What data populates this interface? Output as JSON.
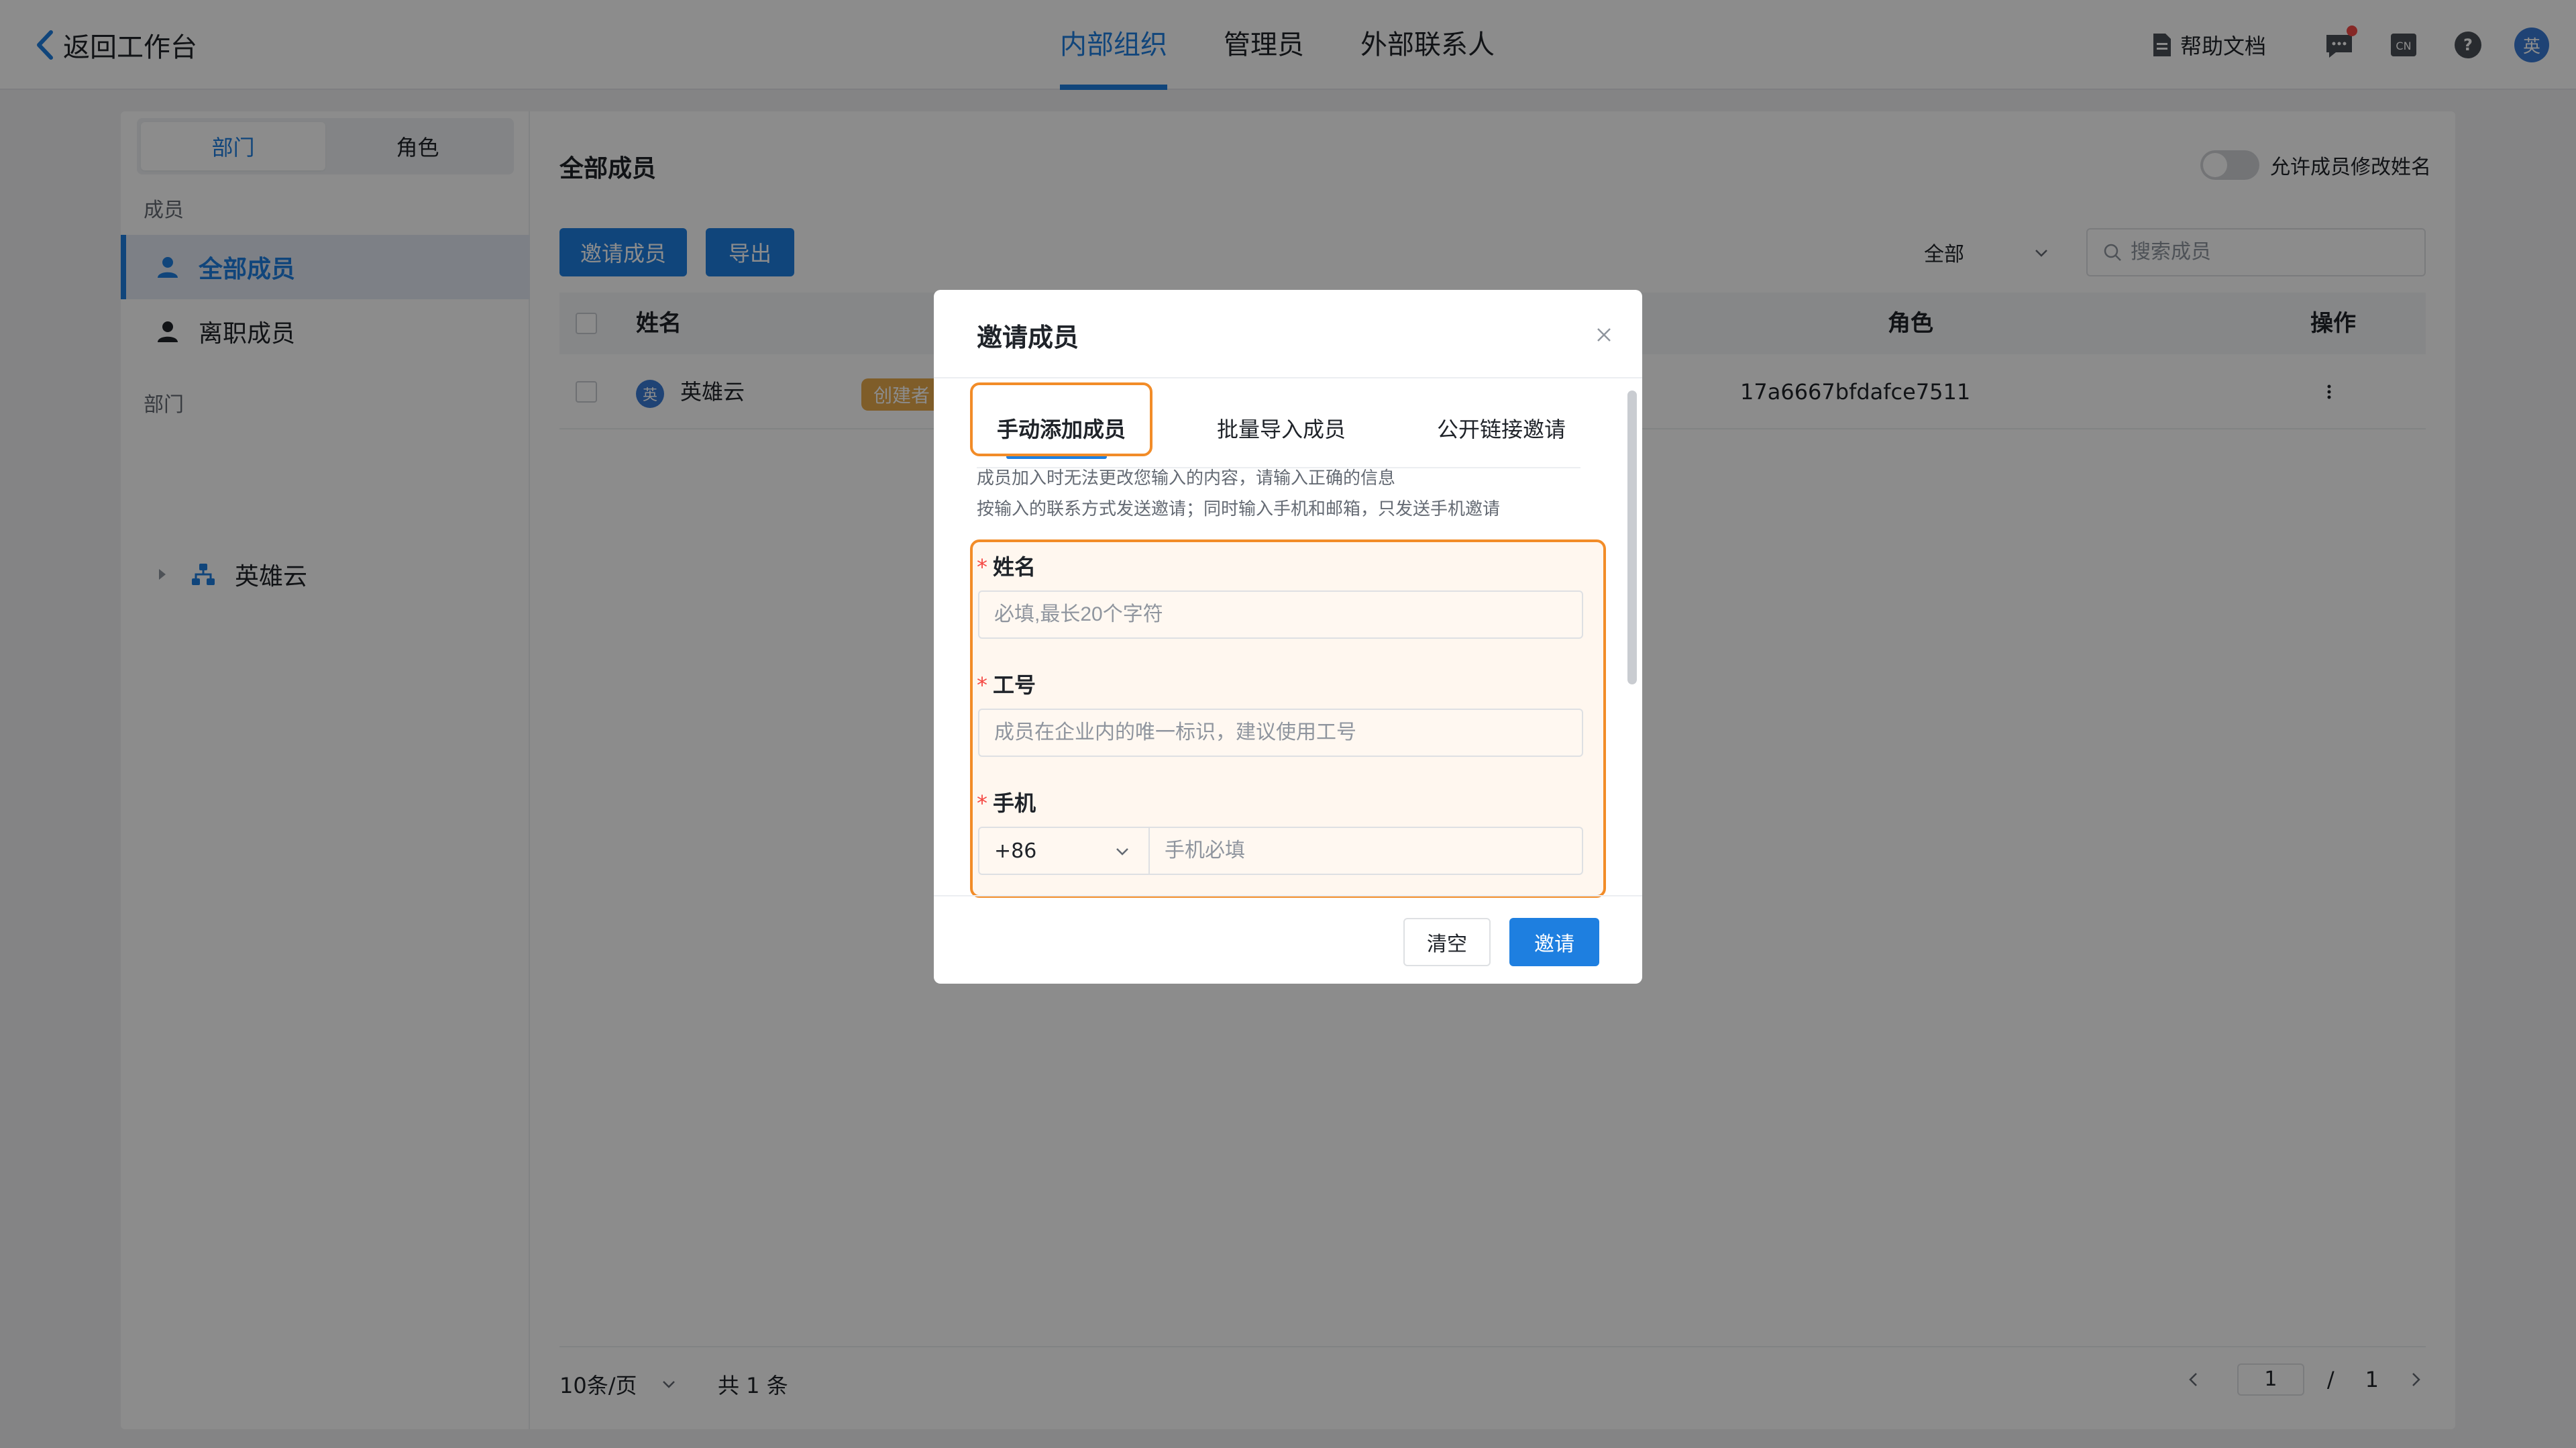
{
  "topbar": {
    "back_label": "返回工作台",
    "tabs": [
      {
        "label": "内部组织",
        "active": true
      },
      {
        "label": "管理员",
        "active": false
      },
      {
        "label": "外部联系人",
        "active": false
      }
    ],
    "help_doc_label": "帮助文档",
    "avatar_text": "英",
    "icons": [
      "message-icon",
      "language-icon",
      "help-icon"
    ]
  },
  "sidebar": {
    "segments": [
      {
        "label": "部门",
        "active": true
      },
      {
        "label": "角色",
        "active": false
      }
    ],
    "members_label": "成员",
    "items": [
      {
        "label": "全部成员",
        "active": true
      },
      {
        "label": "离职成员",
        "active": false
      }
    ],
    "departments_label": "部门",
    "tree": [
      {
        "label": "英雄云"
      }
    ]
  },
  "content": {
    "title": "全部成员",
    "toggle_label": "允许成员修改姓名",
    "invite_button": "邀请成员",
    "export_button": "导出",
    "filter_value": "全部",
    "search_placeholder": "搜索成员",
    "table": {
      "columns": [
        "姓名",
        "角色",
        "操作"
      ],
      "rows": [
        {
          "avatar": "英",
          "name": "英雄云",
          "badge": "创建者",
          "id_fragment": "17a6667bfdafce7511",
          "role": ""
        }
      ]
    },
    "pagination": {
      "page_size": "10条/页",
      "total": "共 1 条",
      "current_page": "1",
      "slash": "/",
      "total_pages": "1"
    }
  },
  "modal": {
    "title": "邀请成员",
    "tabs": [
      {
        "label": "手动添加成员",
        "active": true
      },
      {
        "label": "批量导入成员",
        "active": false
      },
      {
        "label": "公开链接邀请",
        "active": false
      }
    ],
    "hints": [
      "成员加入时无法更改您输入的内容，请输入正确的信息",
      "按输入的联系方式发送邀请；同时输入手机和邮箱，只发送手机邀请"
    ],
    "fields": {
      "name": {
        "required_mark": "*",
        "label": "姓名",
        "placeholder": "必填,最长20个字符"
      },
      "employee_id": {
        "required_mark": "*",
        "label": "工号",
        "placeholder": "成员在企业内的唯一标识，建议使用工号"
      },
      "phone": {
        "required_mark": "*",
        "label": "手机",
        "country_code": "+86",
        "placeholder": "手机必填"
      }
    },
    "clear_button": "清空",
    "invite_button": "邀请"
  },
  "colors": {
    "accent": "#1e7fe0",
    "highlight": "#f28c28",
    "badge": "#e8a94b",
    "required": "#f54a45"
  }
}
